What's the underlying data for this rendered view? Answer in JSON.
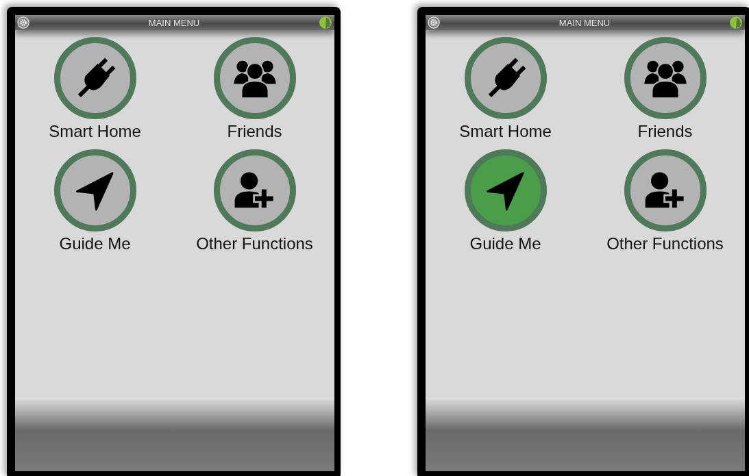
{
  "screens": [
    {
      "header": {
        "title": "MAIN MENU"
      },
      "items": [
        {
          "label": "Smart Home",
          "kind": "plug",
          "selected": false
        },
        {
          "label": "Friends",
          "kind": "group",
          "selected": false
        },
        {
          "label": "Guide Me",
          "kind": "navigate",
          "selected": false
        },
        {
          "label": "Other Functions",
          "kind": "add-person",
          "selected": false
        }
      ]
    },
    {
      "header": {
        "title": "MAIN MENU"
      },
      "items": [
        {
          "label": "Smart Home",
          "kind": "plug",
          "selected": false
        },
        {
          "label": "Friends",
          "kind": "group",
          "selected": false
        },
        {
          "label": "Guide Me",
          "kind": "navigate",
          "selected": true
        },
        {
          "label": "Other Functions",
          "kind": "add-person",
          "selected": false
        }
      ]
    }
  ]
}
